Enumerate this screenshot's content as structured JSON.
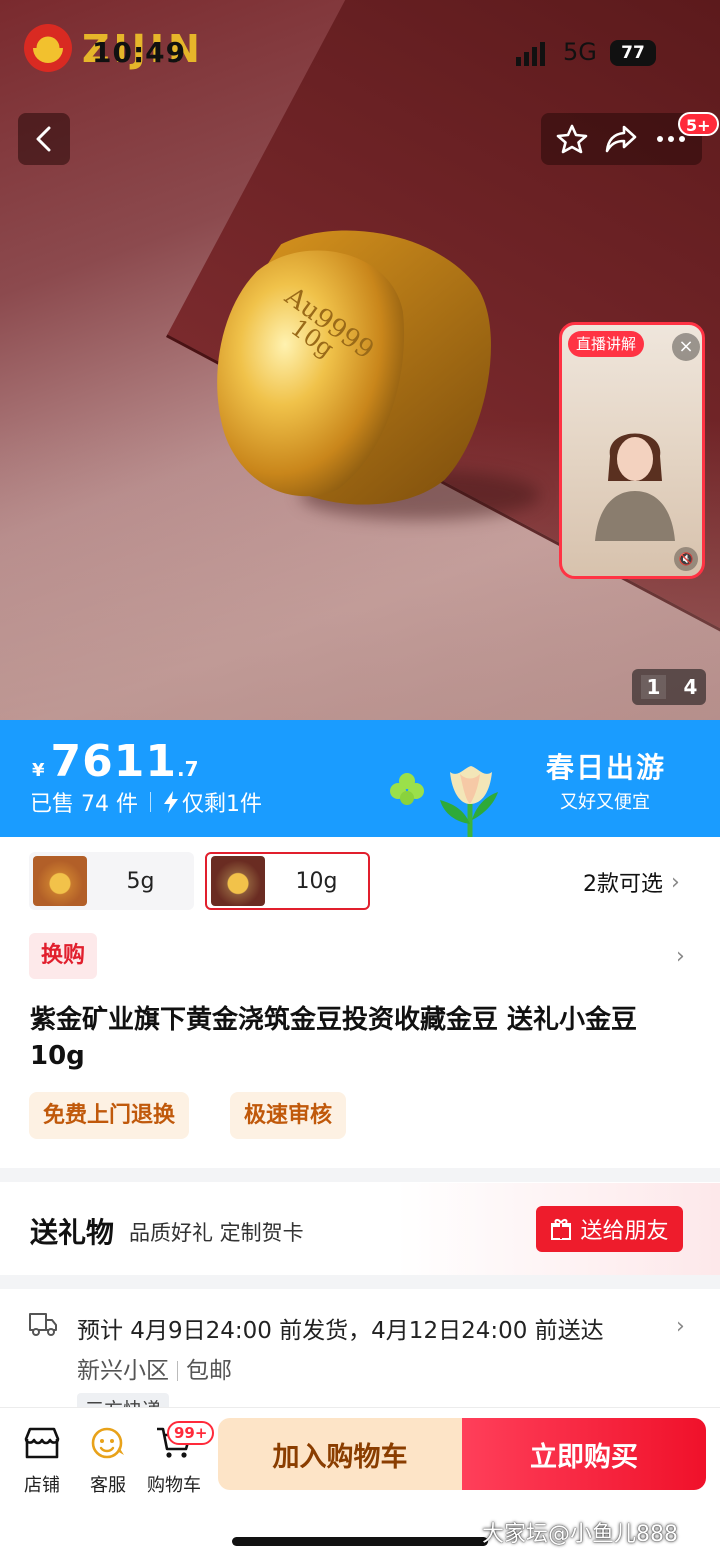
{
  "status_bar": {
    "time": "10:49",
    "network": "5G",
    "battery": "77"
  },
  "brand": {
    "logo_text": "ZIJIN"
  },
  "top_actions": {
    "badge": "5+"
  },
  "live": {
    "label": "直播讲解",
    "close": "×",
    "mute": "🔇"
  },
  "gallery": {
    "current": "1",
    "total": "4"
  },
  "price": {
    "symbol": "¥",
    "integer": "7611",
    "decimal": ".7",
    "sold": "已售 74 件",
    "stock": "仅剩1件",
    "promo_title": "春日出游",
    "promo_subtitle": "又好又便宜"
  },
  "variants": {
    "options": [
      {
        "label": "5g"
      },
      {
        "label": "10g",
        "selected": true
      }
    ],
    "count_label": "2款可选"
  },
  "promo": {
    "tag": "换购"
  },
  "product": {
    "title": "紫金矿业旗下黄金浇筑金豆投资收藏金豆 送礼小金豆 10g"
  },
  "services": [
    "免费上门退换",
    "极速审核"
  ],
  "gift": {
    "title": "送礼物",
    "subtitle": "品质好礼 定制贺卡",
    "button": "送给朋友"
  },
  "delivery": {
    "text": "预计 4月9日24:00 前发货，4月12日24:00 前送达",
    "area": "新兴小区",
    "shipping": "包邮",
    "courier": "三方快递"
  },
  "bottom_bar": {
    "tabs": [
      {
        "label": "店铺"
      },
      {
        "label": "客服"
      },
      {
        "label": "购物车"
      }
    ],
    "cart_badge": "99+",
    "add_to_cart": "加入购物车",
    "buy_now": "立即购买"
  },
  "watermark": "大家坛@小鱼儿888",
  "colors": {
    "price_banner": "#1a9cff",
    "accent_red": "#e11f2d",
    "cart_bg": "#fde4c7",
    "buy_bg": "#f0112a"
  }
}
